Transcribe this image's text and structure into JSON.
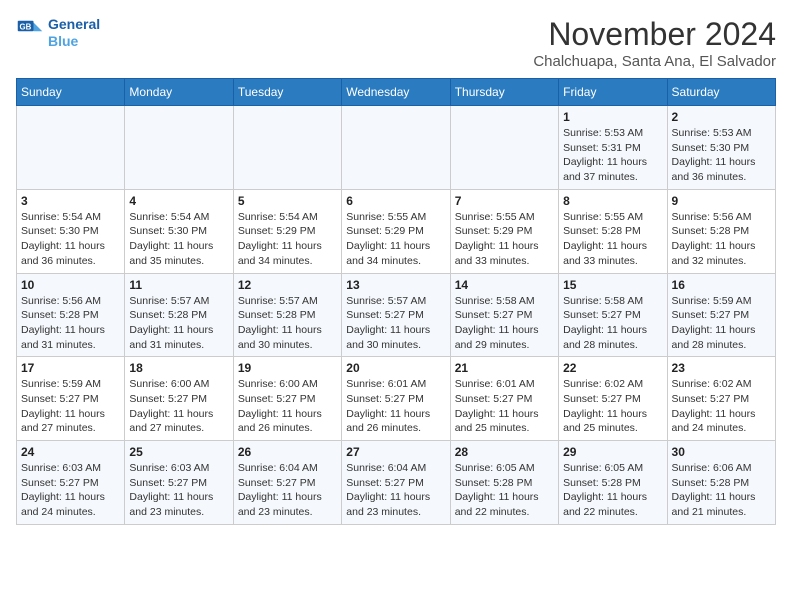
{
  "logo": {
    "line1": "General",
    "line2": "Blue"
  },
  "title": "November 2024",
  "subtitle": "Chalchuapa, Santa Ana, El Salvador",
  "days_of_week": [
    "Sunday",
    "Monday",
    "Tuesday",
    "Wednesday",
    "Thursday",
    "Friday",
    "Saturday"
  ],
  "weeks": [
    [
      {
        "day": "",
        "info": ""
      },
      {
        "day": "",
        "info": ""
      },
      {
        "day": "",
        "info": ""
      },
      {
        "day": "",
        "info": ""
      },
      {
        "day": "",
        "info": ""
      },
      {
        "day": "1",
        "info": "Sunrise: 5:53 AM\nSunset: 5:31 PM\nDaylight: 11 hours\nand 37 minutes."
      },
      {
        "day": "2",
        "info": "Sunrise: 5:53 AM\nSunset: 5:30 PM\nDaylight: 11 hours\nand 36 minutes."
      }
    ],
    [
      {
        "day": "3",
        "info": "Sunrise: 5:54 AM\nSunset: 5:30 PM\nDaylight: 11 hours\nand 36 minutes."
      },
      {
        "day": "4",
        "info": "Sunrise: 5:54 AM\nSunset: 5:30 PM\nDaylight: 11 hours\nand 35 minutes."
      },
      {
        "day": "5",
        "info": "Sunrise: 5:54 AM\nSunset: 5:29 PM\nDaylight: 11 hours\nand 34 minutes."
      },
      {
        "day": "6",
        "info": "Sunrise: 5:55 AM\nSunset: 5:29 PM\nDaylight: 11 hours\nand 34 minutes."
      },
      {
        "day": "7",
        "info": "Sunrise: 5:55 AM\nSunset: 5:29 PM\nDaylight: 11 hours\nand 33 minutes."
      },
      {
        "day": "8",
        "info": "Sunrise: 5:55 AM\nSunset: 5:28 PM\nDaylight: 11 hours\nand 33 minutes."
      },
      {
        "day": "9",
        "info": "Sunrise: 5:56 AM\nSunset: 5:28 PM\nDaylight: 11 hours\nand 32 minutes."
      }
    ],
    [
      {
        "day": "10",
        "info": "Sunrise: 5:56 AM\nSunset: 5:28 PM\nDaylight: 11 hours\nand 31 minutes."
      },
      {
        "day": "11",
        "info": "Sunrise: 5:57 AM\nSunset: 5:28 PM\nDaylight: 11 hours\nand 31 minutes."
      },
      {
        "day": "12",
        "info": "Sunrise: 5:57 AM\nSunset: 5:28 PM\nDaylight: 11 hours\nand 30 minutes."
      },
      {
        "day": "13",
        "info": "Sunrise: 5:57 AM\nSunset: 5:27 PM\nDaylight: 11 hours\nand 30 minutes."
      },
      {
        "day": "14",
        "info": "Sunrise: 5:58 AM\nSunset: 5:27 PM\nDaylight: 11 hours\nand 29 minutes."
      },
      {
        "day": "15",
        "info": "Sunrise: 5:58 AM\nSunset: 5:27 PM\nDaylight: 11 hours\nand 28 minutes."
      },
      {
        "day": "16",
        "info": "Sunrise: 5:59 AM\nSunset: 5:27 PM\nDaylight: 11 hours\nand 28 minutes."
      }
    ],
    [
      {
        "day": "17",
        "info": "Sunrise: 5:59 AM\nSunset: 5:27 PM\nDaylight: 11 hours\nand 27 minutes."
      },
      {
        "day": "18",
        "info": "Sunrise: 6:00 AM\nSunset: 5:27 PM\nDaylight: 11 hours\nand 27 minutes."
      },
      {
        "day": "19",
        "info": "Sunrise: 6:00 AM\nSunset: 5:27 PM\nDaylight: 11 hours\nand 26 minutes."
      },
      {
        "day": "20",
        "info": "Sunrise: 6:01 AM\nSunset: 5:27 PM\nDaylight: 11 hours\nand 26 minutes."
      },
      {
        "day": "21",
        "info": "Sunrise: 6:01 AM\nSunset: 5:27 PM\nDaylight: 11 hours\nand 25 minutes."
      },
      {
        "day": "22",
        "info": "Sunrise: 6:02 AM\nSunset: 5:27 PM\nDaylight: 11 hours\nand 25 minutes."
      },
      {
        "day": "23",
        "info": "Sunrise: 6:02 AM\nSunset: 5:27 PM\nDaylight: 11 hours\nand 24 minutes."
      }
    ],
    [
      {
        "day": "24",
        "info": "Sunrise: 6:03 AM\nSunset: 5:27 PM\nDaylight: 11 hours\nand 24 minutes."
      },
      {
        "day": "25",
        "info": "Sunrise: 6:03 AM\nSunset: 5:27 PM\nDaylight: 11 hours\nand 23 minutes."
      },
      {
        "day": "26",
        "info": "Sunrise: 6:04 AM\nSunset: 5:27 PM\nDaylight: 11 hours\nand 23 minutes."
      },
      {
        "day": "27",
        "info": "Sunrise: 6:04 AM\nSunset: 5:27 PM\nDaylight: 11 hours\nand 23 minutes."
      },
      {
        "day": "28",
        "info": "Sunrise: 6:05 AM\nSunset: 5:28 PM\nDaylight: 11 hours\nand 22 minutes."
      },
      {
        "day": "29",
        "info": "Sunrise: 6:05 AM\nSunset: 5:28 PM\nDaylight: 11 hours\nand 22 minutes."
      },
      {
        "day": "30",
        "info": "Sunrise: 6:06 AM\nSunset: 5:28 PM\nDaylight: 11 hours\nand 21 minutes."
      }
    ]
  ]
}
